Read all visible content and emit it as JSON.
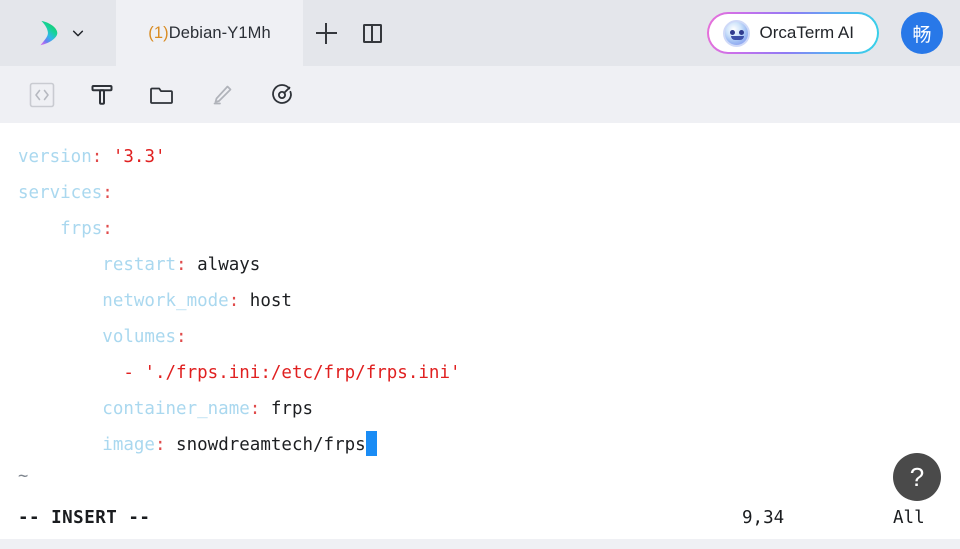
{
  "titlebar": {
    "logo": "orcaterm-logo",
    "logo_caret": "chevron-down-icon",
    "tabs": [
      {
        "badge": "(1)",
        "name": " Debian-Y1Mh"
      }
    ],
    "new_tab_label": "+",
    "new_tab_icon": "plus-icon",
    "split_icon": "split-pane-icon",
    "ai_button": {
      "label": "OrcaTerm AI",
      "avatar_icon": "orca-avatar-icon"
    },
    "user_avatar": {
      "label": "畅",
      "color": "#2878e8"
    }
  },
  "toolbar": {
    "items": [
      {
        "icon": "code-brackets-icon",
        "name": "code-snippet-tool",
        "disabled": true
      },
      {
        "icon": "text-tool-icon",
        "name": "text-tool",
        "disabled": false
      },
      {
        "icon": "folder-icon",
        "name": "file-manager-tool",
        "disabled": false
      },
      {
        "icon": "pencil-icon",
        "name": "edit-tool",
        "disabled": true
      },
      {
        "icon": "gauge-icon",
        "name": "monitor-tool",
        "disabled": false
      }
    ]
  },
  "terminal": {
    "lines": [
      [
        {
          "t": "version",
          "c": "k"
        },
        {
          "t": ":",
          "c": "p"
        },
        {
          "t": " ",
          "c": "v"
        },
        {
          "t": "'3.3'",
          "c": "s"
        }
      ],
      [
        {
          "t": "services",
          "c": "k"
        },
        {
          "t": ":",
          "c": "p"
        }
      ],
      [
        {
          "t": "    frps",
          "c": "k"
        },
        {
          "t": ":",
          "c": "p"
        }
      ],
      [
        {
          "t": "        restart",
          "c": "k"
        },
        {
          "t": ":",
          "c": "p"
        },
        {
          "t": " always",
          "c": "v"
        }
      ],
      [
        {
          "t": "        network_mode",
          "c": "k"
        },
        {
          "t": ":",
          "c": "p"
        },
        {
          "t": " host",
          "c": "v"
        }
      ],
      [
        {
          "t": "        volumes",
          "c": "k"
        },
        {
          "t": ":",
          "c": "p"
        }
      ],
      [
        {
          "t": "          - ",
          "c": "s"
        },
        {
          "t": "'./frps.ini:/etc/frp/frps.ini'",
          "c": "s"
        }
      ],
      [
        {
          "t": "        container_name",
          "c": "k"
        },
        {
          "t": ":",
          "c": "p"
        },
        {
          "t": " frps",
          "c": "v"
        }
      ],
      [
        {
          "t": "        image",
          "c": "k"
        },
        {
          "t": ":",
          "c": "p"
        },
        {
          "t": " snowdreamtech/frps",
          "c": "v"
        },
        {
          "t": "",
          "c": "cursor"
        }
      ]
    ],
    "empty_marker": "~"
  },
  "statusbar": {
    "mode": "-- INSERT --",
    "position": "9,34",
    "scroll": "All"
  },
  "help": {
    "label": "?"
  }
}
